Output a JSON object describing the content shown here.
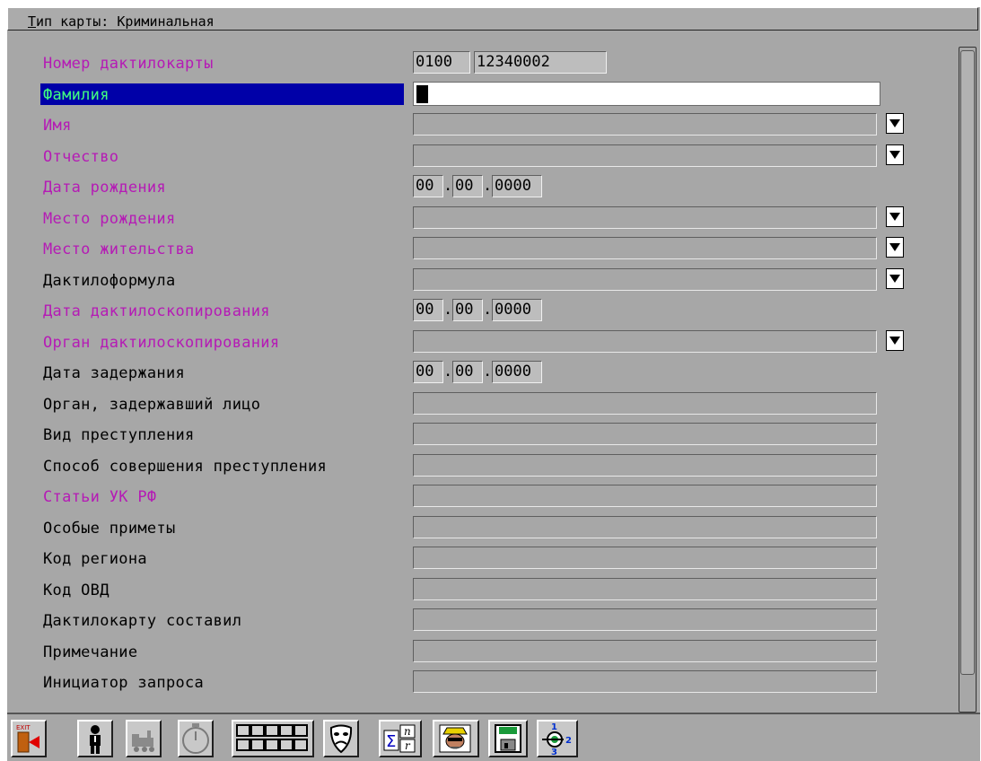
{
  "window": {
    "title_prefix": "Т",
    "title_rest": "ип карты: Криминальная"
  },
  "fields": [
    {
      "label": "Номер дактилокарты",
      "required": true,
      "type": "number",
      "part1": "0100",
      "part2": "12340002"
    },
    {
      "label": "Фамилия",
      "required": true,
      "type": "text-active",
      "value": ""
    },
    {
      "label": "Имя",
      "required": true,
      "type": "combo",
      "value": ""
    },
    {
      "label": "Отчество",
      "required": true,
      "type": "combo",
      "value": ""
    },
    {
      "label": "Дата рождения",
      "required": true,
      "type": "date",
      "day": "00",
      "month": "00",
      "year": "0000"
    },
    {
      "label": "Место рождения",
      "required": true,
      "type": "combo",
      "value": ""
    },
    {
      "label": "Место жительства",
      "required": true,
      "type": "combo",
      "value": ""
    },
    {
      "label": "Дактилоформула",
      "required": false,
      "type": "combo",
      "value": ""
    },
    {
      "label": "Дата дактилоскопирования",
      "required": true,
      "type": "date",
      "day": "00",
      "month": "00",
      "year": "0000"
    },
    {
      "label": "Орган дактилоскопирования",
      "required": true,
      "type": "combo",
      "value": ""
    },
    {
      "label": "Дата задержания",
      "required": false,
      "type": "date",
      "day": "00",
      "month": "00",
      "year": "0000"
    },
    {
      "label": "Орган, задержавший лицо",
      "required": false,
      "type": "text",
      "value": ""
    },
    {
      "label": "Вид преступления",
      "required": false,
      "type": "text",
      "value": ""
    },
    {
      "label": "Способ совершения преступления",
      "required": false,
      "type": "text",
      "value": ""
    },
    {
      "label": "Статьи УК РФ",
      "required": true,
      "type": "text",
      "value": ""
    },
    {
      "label": "Особые приметы",
      "required": false,
      "type": "text",
      "value": ""
    },
    {
      "label": "Код региона",
      "required": false,
      "type": "text",
      "value": ""
    },
    {
      "label": "Код ОВД",
      "required": false,
      "type": "text",
      "value": ""
    },
    {
      "label": "Дактилокарту составил",
      "required": false,
      "type": "text",
      "value": ""
    },
    {
      "label": "Примечание",
      "required": false,
      "type": "text",
      "value": ""
    },
    {
      "label": "Инициатор запроса",
      "required": false,
      "type": "text",
      "value": ""
    }
  ],
  "toolbar": [
    {
      "icon": "exit-door-icon",
      "label": "EXIT"
    },
    {
      "icon": "person-icon"
    },
    {
      "icon": "train-icon",
      "disabled": true
    },
    {
      "icon": "stopwatch-icon",
      "disabled": true
    },
    {
      "icon": "fingerprint-grid-icon"
    },
    {
      "icon": "theater-mask-icon"
    },
    {
      "icon": "sigma-statistics-icon",
      "label_top": "n",
      "label_bottom": "r"
    },
    {
      "icon": "detective-icon"
    },
    {
      "icon": "floppy-save-icon"
    },
    {
      "icon": "network-123-icon",
      "label_1": "1",
      "label_2": "2",
      "label_3": "3"
    }
  ],
  "colors": {
    "required_label": "#b51bb5",
    "normal_label": "#000000",
    "selection_bg": "#0000a8",
    "selection_text": "#40ff80",
    "window_bg": "#a7a7a7"
  }
}
